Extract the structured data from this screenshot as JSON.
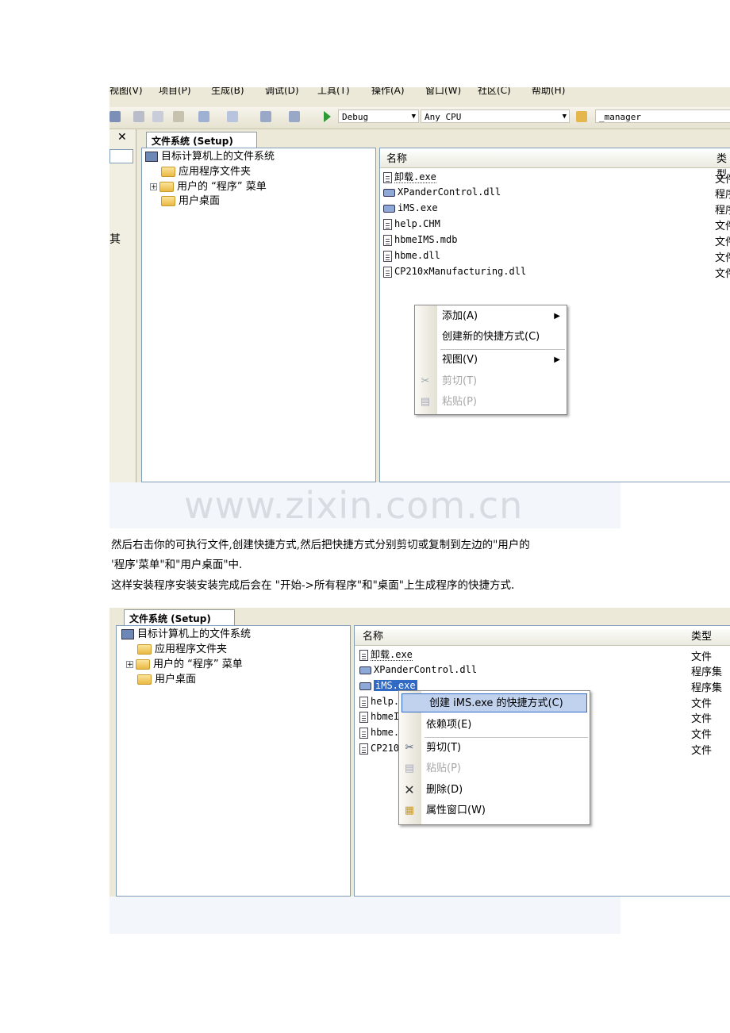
{
  "shot1": {
    "menu": {
      "items": [
        "视图(V)",
        "项目(P)",
        "生成(B)",
        "调试(D)",
        "工具(T)",
        "操作(A)",
        "窗口(W)",
        "社区(C)",
        "帮助(H)"
      ]
    },
    "toolbar": {
      "config": "Debug",
      "platform": "Any CPU",
      "project": "_manager"
    },
    "left_close": "✕",
    "left_fragment": "其",
    "tab_label": "文件系统 (Setup)",
    "tree": {
      "root": "目标计算机上的文件系统",
      "items": [
        "应用程序文件夹",
        "用户的 “程序” 菜单",
        "用户桌面"
      ]
    },
    "list": {
      "col_name": "名称",
      "col_type": "类型",
      "files": [
        {
          "name": "卸载.exe",
          "type": "文件"
        },
        {
          "name": "XPanderControl.dll",
          "type": "程序"
        },
        {
          "name": "iMS.exe",
          "type": "程序"
        },
        {
          "name": "help.CHM",
          "type": "文件"
        },
        {
          "name": "hbmeIMS.mdb",
          "type": "文件"
        },
        {
          "name": "hbme.dll",
          "type": "文件"
        },
        {
          "name": "CP210xManufacturing.dll",
          "type": "文件"
        }
      ]
    },
    "context_menu": {
      "items": [
        {
          "label": "添加(A)",
          "submenu": true
        },
        {
          "label": "创建新的快捷方式(C)"
        },
        {
          "label": "视图(V)",
          "submenu": true
        },
        {
          "label": "剪切(T)",
          "disabled": true
        },
        {
          "label": "粘贴(P)",
          "disabled": true
        }
      ]
    }
  },
  "watermark": "www.zixin.com.cn",
  "paragraphs": [
    "然后右击你的可执行文件,创建快捷方式,然后把快捷方式分别剪切或复制到左边的\"用户的",
    "'程序'菜单\"和\"用户桌面\"中.",
    "这样安装程序安装安装完成后会在 \"开始->所有程序\"和\"桌面\"上生成程序的快捷方式."
  ],
  "shot2": {
    "tab_label": "文件系统 (Setup)",
    "tree": {
      "root": "目标计算机上的文件系统",
      "items": [
        "应用程序文件夹",
        "用户的 “程序” 菜单",
        "用户桌面"
      ]
    },
    "list": {
      "col_name": "名称",
      "col_type": "类型",
      "files": [
        {
          "name": "卸载.exe",
          "type": "文件"
        },
        {
          "name": "XPanderControl.dll",
          "type": "程序集"
        },
        {
          "name": "iMS.exe",
          "type": "程序集"
        },
        {
          "name": "help.",
          "type": "文件"
        },
        {
          "name": "hbmeI",
          "type": "文件"
        },
        {
          "name": "hbme.",
          "type": "文件"
        },
        {
          "name": "CP210",
          "type": "文件"
        }
      ]
    },
    "context_menu": {
      "items": [
        {
          "label": "创建 iMS.exe 的快捷方式(C)",
          "highlighted": true
        },
        {
          "label": "依赖项(E)"
        },
        {
          "label": "剪切(T)"
        },
        {
          "label": "粘贴(P)",
          "disabled": true
        },
        {
          "label": "删除(D)"
        },
        {
          "label": "属性窗口(W)"
        }
      ]
    }
  }
}
